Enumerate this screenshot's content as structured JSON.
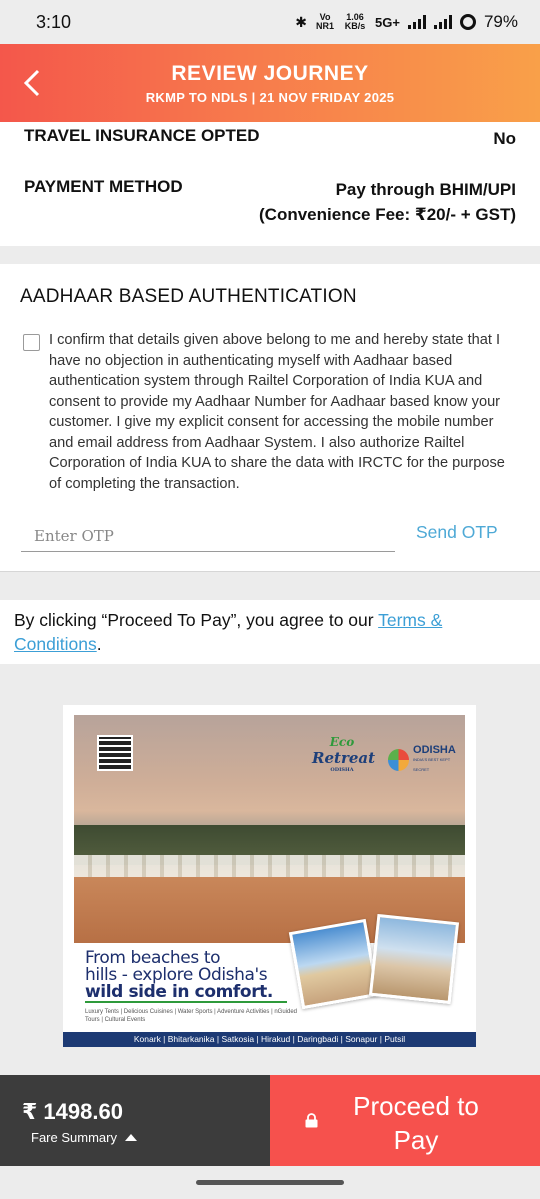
{
  "status_bar": {
    "time": "3:10",
    "network_small": "Vo NR1",
    "speed": "1.06 KB/s",
    "network": "5G+",
    "battery": "79%"
  },
  "header": {
    "title": "REVIEW JOURNEY",
    "subtitle": "RKMP TO NDLS | 21 NOV FRIDAY 2025",
    "back_icon": "chevron-left-icon"
  },
  "summary": {
    "insurance_label": "TRAVEL INSURANCE OPTED",
    "insurance_value": "No",
    "payment_label": "PAYMENT METHOD",
    "payment_value": "Pay through BHIM/UPI",
    "payment_fee": "(Convenience Fee: ₹20/- + GST)"
  },
  "aadhaar": {
    "title": "AADHAAR BASED AUTHENTICATION",
    "consent_text": "I confirm that details given above belong to me and hereby state that I have no objection in authenticating myself with Aadhaar based authentication system through Railtel Corporation of India KUA and consent to provide my Aadhaar Number for Aadhaar based know your customer. I give my explicit consent for accessing the mobile number and email address from Aadhaar System. I also authorize Railtel Corporation of India KUA to share the data with IRCTC for the purpose of completing the transaction.",
    "otp_placeholder": "Enter OTP",
    "send_otp": "Send OTP"
  },
  "terms": {
    "prefix": "By clicking “Proceed To Pay”, you agree to our ",
    "link": "Terms & Conditions",
    "suffix": "."
  },
  "ad": {
    "brand_eco": "Eco",
    "brand_retreat": "Retreat",
    "brand_region": "ODISHA",
    "logo_name": "ODISHA",
    "logo_tagline": "INDIA'S BEST KEPT SECRET",
    "headline_line1": "From beaches to",
    "headline_line2": "hills - explore Odisha's",
    "headline_line3": "wild side in comfort.",
    "features": "Luxury Tents | Delicious Cuisines | Water Sports | Adventure Activities | nGuided Tours | Cultural Events",
    "locations": "Konark | Bhitarkanika | Satkosia | Hirakud | Daringbadi | Sonapur | Putsil"
  },
  "bottom_bar": {
    "amount": "₹ 1498.60",
    "fare_summary": "Fare Summary",
    "proceed_label": "Proceed to Pay",
    "lock_icon": "lock-icon",
    "accent_color": "#f6514d"
  }
}
